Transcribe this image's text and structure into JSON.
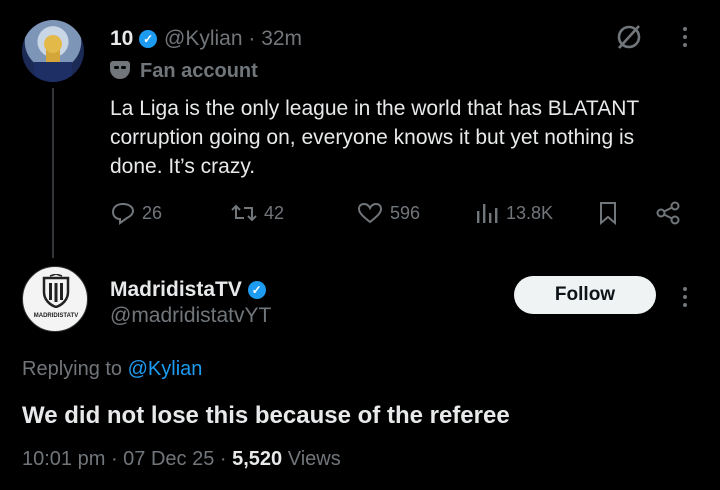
{
  "parent_tweet": {
    "name": "10",
    "handle": "@Kylian",
    "time": "32m",
    "badge": "Fan account",
    "text": "La Liga is the only league in the world that has BLATANT corruption going on, everyone knows it but yet nothing is done. It’s crazy.",
    "replies": "26",
    "reposts": "42",
    "likes": "596",
    "views": "13.8K"
  },
  "reply_tweet": {
    "name": "MadridistaTV",
    "handle": "@madridistatvYT",
    "avatar_text": "MADRIDISTATV",
    "follow_label": "Follow",
    "replying_prefix": "Replying to",
    "replying_handle": "@Kylian",
    "text": "We did not lose this because of the referee",
    "time": "10:01 pm",
    "date": "07 Dec 25",
    "views_count": "5,520",
    "views_label": "Views"
  },
  "colors": {
    "background": "#000000",
    "text": "#e7e9ea",
    "muted": "#71767b",
    "accent": "#1d9bf0",
    "follow_bg": "#eff3f4"
  },
  "icons": [
    "verified-icon",
    "grok-icon",
    "more-icon",
    "fan-mask-icon",
    "reply-icon",
    "repost-icon",
    "like-icon",
    "views-icon",
    "bookmark-icon",
    "share-icon"
  ]
}
